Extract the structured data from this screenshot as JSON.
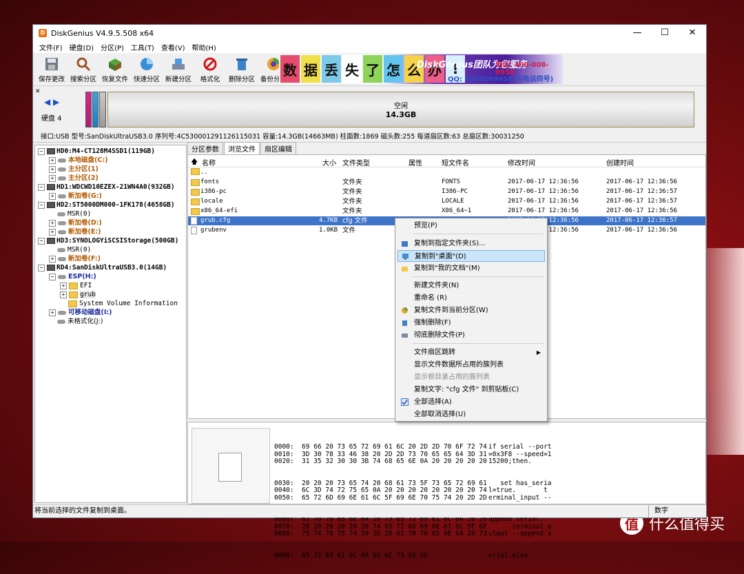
{
  "window": {
    "title": "DiskGenius V4.9.5.508 x64"
  },
  "menu": [
    "文件(F)",
    "硬盘(D)",
    "分区(P)",
    "工具(T)",
    "查看(V)",
    "帮助(H)"
  ],
  "toolbar": [
    "保存更改",
    "搜索分区",
    "恢复文件",
    "快速分区",
    "新建分区",
    "格式化",
    "删除分区",
    "备份分区"
  ],
  "banner": {
    "chars": [
      "数",
      "据",
      "丢",
      "失",
      "了",
      "怎",
      "么",
      "办",
      "!"
    ],
    "brand": "DiskGenius团队为您服务",
    "phone": "电话: 400-008-9958",
    "qq": "QQ: 4000089958(与电话同号)"
  },
  "disk": {
    "label": "硬盘 4",
    "free_title": "空闲",
    "free_size": "14.3GB",
    "info": "接口:USB   型号:SanDiskUltraUSB3.0   序列号:4C530001291126115031   容量:14.3GB(14663MB)   柱面数:1869   磁头数:255   每道扇区数:63   总扇区数:30031250"
  },
  "tree": {
    "hd0": "HD0:M4-CT128M4SSD1(119GB)",
    "hd0_c": "本地磁盘(C:)",
    "hd0_p1": "主分区(1)",
    "hd0_p2": "主分区(2)",
    "hd1": "HD1:WDCWD10EZEX-21WN4A0(932GB)",
    "hd1_g": "新加卷(G:)",
    "hd2": "HD2:ST5000DM000-1FK178(4658GB)",
    "hd2_msr": "MSR(0)",
    "hd2_d": "新加卷(D:)",
    "hd2_e": "新加卷(E:)",
    "hd3": "HD3:SYNOLOGYiSCSIStorage(500GB)",
    "hd3_msr": "MSR(0)",
    "hd3_f": "新加卷(F:)",
    "rd4": "RD4:SanDiskUltraUSB3.0(14GB)",
    "rd4_esp": "ESP(H:)",
    "rd4_efi": "EFI",
    "rd4_grub": "grub",
    "rd4_svi": "System Volume Information",
    "rd4_i": "可移动磁盘(I:)",
    "rd4_j": "未格式化(J:)"
  },
  "tabs": [
    "分区参数",
    "浏览文件",
    "扇区编辑"
  ],
  "columns": [
    "名称",
    "大小",
    "文件类型",
    "属性",
    "短文件名",
    "修改时间",
    "创建时间"
  ],
  "files": [
    {
      "name": "..",
      "size": "",
      "type": "",
      "attr": "",
      "short": "",
      "mtime": "",
      "ctime": ""
    },
    {
      "name": "fonts",
      "size": "",
      "type": "文件夹",
      "attr": "",
      "short": "FONTS",
      "mtime": "2017-06-17 12:36:56",
      "ctime": "2017-06-17 12:36:56"
    },
    {
      "name": "i386-pc",
      "size": "",
      "type": "文件夹",
      "attr": "",
      "short": "I386-PC",
      "mtime": "2017-06-17 12:36:56",
      "ctime": "2017-06-17 12:36:57"
    },
    {
      "name": "locale",
      "size": "",
      "type": "文件夹",
      "attr": "",
      "short": "LOCALE",
      "mtime": "2017-06-17 12:36:56",
      "ctime": "2017-06-17 12:36:57"
    },
    {
      "name": "x86_64-efi",
      "size": "",
      "type": "文件夹",
      "attr": "",
      "short": "X86_64~1",
      "mtime": "2017-06-17 12:36:56",
      "ctime": "2017-06-17 12:36:56"
    },
    {
      "name": "grub.cfg",
      "size": "4.7KB",
      "type": "cfg 文件",
      "attr": "",
      "short": "",
      "mtime": "2017-06-17 12:36:56",
      "ctime": "2017-06-17 12:36:57"
    },
    {
      "name": "grubenv",
      "size": "1.0KB",
      "type": "文件",
      "attr": "",
      "short": "",
      "mtime": "2017-06-17 12:36:56",
      "ctime": "2017-06-17 12:36:56"
    }
  ],
  "hex_lines": [
    "0000:  69 66 20 73 65 72 69 61 6C 20 2D 2D 70 6F 72 74",
    "0010:  3D 30 78 33 46 38 20 2D 2D 73 70 65 65 64 3D 31",
    "0020:  31 35 32 30 30 3B 74 68 65 6E 0A 20 20 20 20 20",
    "0030:  20 20 20 73 65 74 20 68 61 73 5F 73 65 72 69 61",
    "0040:  6C 3D 74 72 75 65 0A 20 20 20 20 20 20 20 20 74",
    "0050:  65 72 6D 69 6E 61 6C 5F 69 6E 70 75 74 20 2D 2D",
    "0060:  61 70 70 65 6E 64 20 73 65 72 69 61 6C 0A 20 20",
    "0070:  20 20 20 20 20 20 74 65 72 6D 69 6E 61 6C 5F 6F",
    "0080:  75 74 70 75 74 20 2D 2D 61 70 70 65 6E 64 20 73",
    "0090:  65 72 69 61 6C 0A 65 6C 73 65 2E"
  ],
  "ascii_lines": [
    "if serial --port",
    "=0x3F8 --speed=1",
    "15200;then.",
    "   set has_seria",
    "l=true.       t",
    "erminal_input --",
    "append serial.",
    "      terminal_o",
    "utput --append s",
    "erial.else."
  ],
  "context_menu": [
    {
      "label": "预览(P)",
      "icon": "",
      "hl": false,
      "dis": false
    },
    {
      "label": "复制到指定文件夹(S)...",
      "icon": "copy-folder-icon",
      "hl": false,
      "dis": false
    },
    {
      "label": "复制到\"桌面\"(D)",
      "icon": "desktop-icon",
      "hl": true,
      "dis": false
    },
    {
      "label": "复制到\"我的文档\"(M)",
      "icon": "documents-folder-icon",
      "hl": false,
      "dis": false
    },
    {
      "label": "新建文件夹(N)",
      "icon": "",
      "hl": false,
      "dis": false
    },
    {
      "label": "重命名 (R)",
      "icon": "",
      "hl": false,
      "dis": false
    },
    {
      "label": "复制文件到当前分区(W)",
      "icon": "partition-icon",
      "hl": false,
      "dis": false
    },
    {
      "label": "强制删除(F)",
      "icon": "delete-icon",
      "hl": false,
      "dis": false
    },
    {
      "label": "彻底删除文件(P)",
      "icon": "shred-icon",
      "hl": false,
      "dis": false
    },
    {
      "label": "文件扇区跳转",
      "icon": "",
      "hl": false,
      "dis": false
    },
    {
      "label": "显示文件数据所占用的簇列表",
      "icon": "",
      "hl": false,
      "dis": false
    },
    {
      "label": "显示根目录占用的簇列表",
      "icon": "",
      "hl": false,
      "dis": true
    },
    {
      "label": "复制文字: \"cfg 文件\" 到剪贴板(C)",
      "icon": "",
      "hl": false,
      "dis": false
    },
    {
      "label": "全部选择(A)",
      "icon": "check-icon",
      "hl": false,
      "dis": false
    },
    {
      "label": "全部取消选择(U)",
      "icon": "",
      "hl": false,
      "dis": false
    }
  ],
  "status": {
    "text": "将当前选择的文件复制到桌面。",
    "mode": "数字"
  },
  "watermark": {
    "logo": "值",
    "text": "什么值得买"
  }
}
